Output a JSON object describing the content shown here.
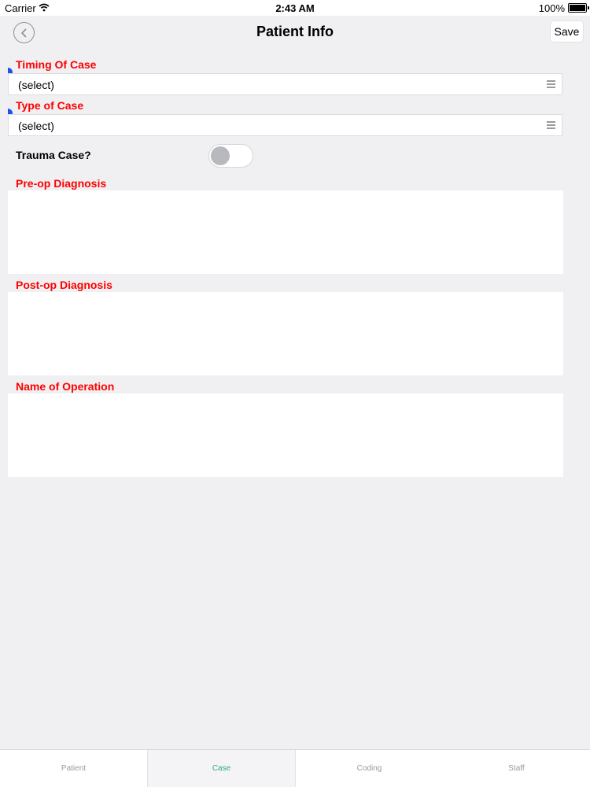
{
  "status_bar": {
    "carrier": "Carrier",
    "time": "2:43 AM",
    "battery": "100%"
  },
  "nav": {
    "title": "Patient Info",
    "save_label": "Save"
  },
  "form": {
    "timing_label": "Timing Of Case",
    "timing_value": "(select)",
    "type_label": "Type of Case",
    "type_value": "(select)",
    "trauma_label": "Trauma Case?",
    "trauma_on": false,
    "preop_label": "Pre-op Diagnosis",
    "preop_value": "",
    "postop_label": "Post-op Diagnosis",
    "postop_value": "",
    "operation_label": "Name of Operation",
    "operation_value": ""
  },
  "tabs": [
    {
      "label": "Patient",
      "active": false
    },
    {
      "label": "Case",
      "active": true
    },
    {
      "label": "Coding",
      "active": false
    },
    {
      "label": "Staff",
      "active": false
    }
  ],
  "colors": {
    "required_label": "#ff0000",
    "active_tab": "#2fa888",
    "marker": "#1a52f2"
  }
}
